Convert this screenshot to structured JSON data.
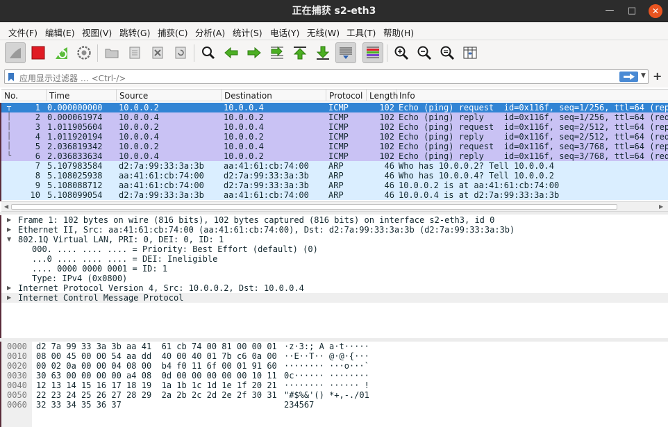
{
  "window": {
    "title": "正在捕获 s2-eth3",
    "minimize": "—",
    "maximize": "□",
    "close": "✕"
  },
  "menu": [
    "文件(F)",
    "编辑(E)",
    "视图(V)",
    "跳转(G)",
    "捕获(C)",
    "分析(A)",
    "统计(S)",
    "电话(Y)",
    "无线(W)",
    "工具(T)",
    "帮助(H)"
  ],
  "toolbar": {
    "icons": [
      "shark-fin-start-icon",
      "stop-square-icon",
      "restart-capture-icon",
      "capture-options-gear-icon",
      "open-folder-icon",
      "save-file-icon",
      "close-file-icon",
      "reload-icon",
      "search-magnifier-icon",
      "go-back-arrow-icon",
      "go-forward-arrow-icon",
      "go-to-packet-icon",
      "first-packet-icon",
      "last-packet-icon",
      "autoscroll-icon",
      "colorize-icon",
      "zoom-in-icon",
      "zoom-out-icon",
      "zoom-normal-icon",
      "resize-columns-icon"
    ],
    "colors": {
      "stop": "#e01b24",
      "arrows": "#4caf23"
    }
  },
  "filter": {
    "placeholder": "应用显示过滤器 … <Ctrl-/>",
    "apply_icon": "apply-arrow-icon",
    "dropdown_icon": "chevron-down-icon",
    "add_label": "+"
  },
  "packet_list": {
    "columns": [
      "No.",
      "Time",
      "Source",
      "Destination",
      "Protocol",
      "Length",
      "Info"
    ],
    "rows": [
      {
        "no": "1",
        "time": "0.000000000",
        "src": "10.0.0.2",
        "dst": "10.0.0.4",
        "proto": "ICMP",
        "len": "102",
        "info": "Echo (ping) request  id=0x116f, seq=1/256, ttl=64 (rep",
        "kind": "sel"
      },
      {
        "no": "2",
        "time": "0.000061974",
        "src": "10.0.0.4",
        "dst": "10.0.0.2",
        "proto": "ICMP",
        "len": "102",
        "info": "Echo (ping) reply    id=0x116f, seq=1/256, ttl=64 (req",
        "kind": "icmp"
      },
      {
        "no": "3",
        "time": "1.011905604",
        "src": "10.0.0.2",
        "dst": "10.0.0.4",
        "proto": "ICMP",
        "len": "102",
        "info": "Echo (ping) request  id=0x116f, seq=2/512, ttl=64 (rep",
        "kind": "icmp"
      },
      {
        "no": "4",
        "time": "1.011920194",
        "src": "10.0.0.4",
        "dst": "10.0.0.2",
        "proto": "ICMP",
        "len": "102",
        "info": "Echo (ping) reply    id=0x116f, seq=2/512, ttl=64 (req",
        "kind": "icmp"
      },
      {
        "no": "5",
        "time": "2.036819342",
        "src": "10.0.0.2",
        "dst": "10.0.0.4",
        "proto": "ICMP",
        "len": "102",
        "info": "Echo (ping) request  id=0x116f, seq=3/768, ttl=64 (rep",
        "kind": "icmp"
      },
      {
        "no": "6",
        "time": "2.036833634",
        "src": "10.0.0.4",
        "dst": "10.0.0.2",
        "proto": "ICMP",
        "len": "102",
        "info": "Echo (ping) reply    id=0x116f, seq=3/768, ttl=64 (req",
        "kind": "icmp"
      },
      {
        "no": "7",
        "time": "5.107983584",
        "src": "d2:7a:99:33:3a:3b",
        "dst": "aa:41:61:cb:74:00",
        "proto": "ARP",
        "len": "46",
        "info": "Who has 10.0.0.2? Tell 10.0.0.4",
        "kind": "arp"
      },
      {
        "no": "8",
        "time": "5.108025938",
        "src": "aa:41:61:cb:74:00",
        "dst": "d2:7a:99:33:3a:3b",
        "proto": "ARP",
        "len": "46",
        "info": "Who has 10.0.0.4? Tell 10.0.0.2",
        "kind": "arp"
      },
      {
        "no": "9",
        "time": "5.108088712",
        "src": "aa:41:61:cb:74:00",
        "dst": "d2:7a:99:33:3a:3b",
        "proto": "ARP",
        "len": "46",
        "info": "10.0.0.2 is at aa:41:61:cb:74:00",
        "kind": "arp"
      },
      {
        "no": "10",
        "time": "5.108099054",
        "src": "d2:7a:99:33:3a:3b",
        "dst": "aa:41:61:cb:74:00",
        "proto": "ARP",
        "len": "46",
        "info": "10.0.0.4 is at d2:7a:99:33:3a:3b",
        "kind": "arp"
      }
    ],
    "row_colors": {
      "selected": "#3184d4",
      "icmp": "#c9c2f4",
      "arp": "#daeeff"
    }
  },
  "details": [
    {
      "text": "Frame 1: 102 bytes on wire (816 bits), 102 bytes captured (816 bits) on interface s2-eth3, id 0",
      "indent": 0,
      "arrow": "right",
      "shaded": false
    },
    {
      "text": "Ethernet II, Src: aa:41:61:cb:74:00 (aa:41:61:cb:74:00), Dst: d2:7a:99:33:3a:3b (d2:7a:99:33:3a:3b)",
      "indent": 0,
      "arrow": "right",
      "shaded": false
    },
    {
      "text": "802.1Q Virtual LAN, PRI: 0, DEI: 0, ID: 1",
      "indent": 0,
      "arrow": "down",
      "shaded": false
    },
    {
      "text": "000. .... .... .... = Priority: Best Effort (default) (0)",
      "indent": 1,
      "arrow": "",
      "shaded": false
    },
    {
      "text": "...0 .... .... .... = DEI: Ineligible",
      "indent": 1,
      "arrow": "",
      "shaded": false
    },
    {
      "text": ".... 0000 0000 0001 = ID: 1",
      "indent": 1,
      "arrow": "",
      "shaded": false
    },
    {
      "text": "Type: IPv4 (0x0800)",
      "indent": 1,
      "arrow": "",
      "shaded": false
    },
    {
      "text": "Internet Protocol Version 4, Src: 10.0.0.2, Dst: 10.0.0.4",
      "indent": 0,
      "arrow": "right",
      "shaded": false
    },
    {
      "text": "Internet Control Message Protocol",
      "indent": 0,
      "arrow": "right",
      "shaded": true
    }
  ],
  "bytes": [
    {
      "off": "0000",
      "hex": "d2 7a 99 33 3a 3b aa 41  61 cb 74 00 81 00 00 01",
      "ascii": "·z·3:; A a·t·····"
    },
    {
      "off": "0010",
      "hex": "08 00 45 00 00 54 aa dd  40 00 40 01 7b c6 0a 00",
      "ascii": "··E··T·· @·@·{···"
    },
    {
      "off": "0020",
      "hex": "00 02 0a 00 00 04 08 00  b4 f0 11 6f 00 01 91 60",
      "ascii": "········ ···o···`"
    },
    {
      "off": "0030",
      "hex": "30 63 00 00 00 00 a4 08  0d 00 00 00 00 00 10 11",
      "ascii": "0c······ ········"
    },
    {
      "off": "0040",
      "hex": "12 13 14 15 16 17 18 19  1a 1b 1c 1d 1e 1f 20 21",
      "ascii": "········ ······ !"
    },
    {
      "off": "0050",
      "hex": "22 23 24 25 26 27 28 29  2a 2b 2c 2d 2e 2f 30 31",
      "ascii": "\"#$%&'() *+,-./01"
    },
    {
      "off": "0060",
      "hex": "32 33 34 35 36 37",
      "ascii": "234567"
    }
  ]
}
